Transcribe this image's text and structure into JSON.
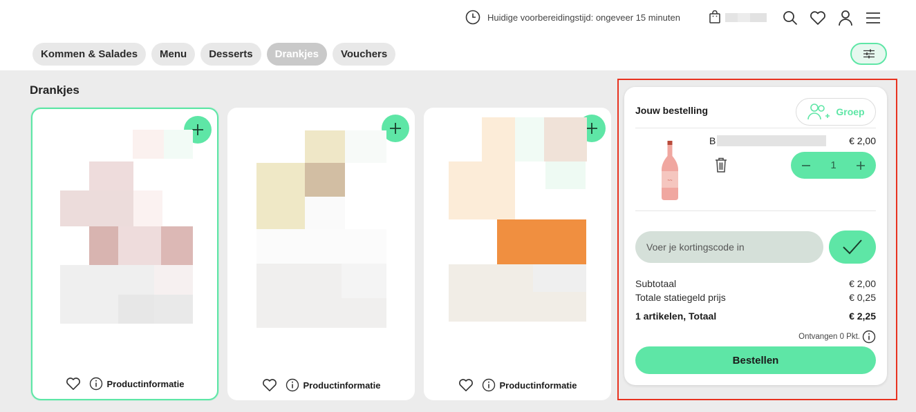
{
  "header": {
    "prep_time_text": "Huidige voorbereidingstijd: ongeveer 15 minuten",
    "icons": [
      "clock-icon",
      "shopping-bag-icon",
      "search-icon",
      "heart-icon",
      "user-icon",
      "menu-icon"
    ]
  },
  "tabs": [
    {
      "label": "Kommen & Salades",
      "active": false
    },
    {
      "label": "Menu",
      "active": false
    },
    {
      "label": "Desserts",
      "active": false
    },
    {
      "label": "Drankjes",
      "active": true
    },
    {
      "label": "Vouchers",
      "active": false
    }
  ],
  "section": {
    "title": "Drankjes"
  },
  "products": [
    {
      "info_label": "Productinformatie",
      "selected": true
    },
    {
      "info_label": "Productinformatie",
      "selected": false
    },
    {
      "info_label": "Productinformatie",
      "selected": false
    }
  ],
  "order": {
    "title": "Jouw bestelling",
    "group_label": "Groep",
    "item": {
      "name_prefix": "B",
      "price": "€ 2,00",
      "quantity": "1"
    },
    "coupon_placeholder": "Voer je kortingscode in",
    "subtotal_label": "Subtotaal",
    "subtotal_value": "€ 2,00",
    "deposit_label": "Totale statiegeld prijs",
    "deposit_value": "€ 0,25",
    "total_label": "1 artikelen, Totaal",
    "total_value": "€ 2,25",
    "points_text": "Ontvangen 0 Pkt.",
    "order_button": "Bestellen"
  },
  "colors": {
    "accent": "#5ee6a6",
    "highlight": "#e8321f",
    "background": "#ececec"
  }
}
